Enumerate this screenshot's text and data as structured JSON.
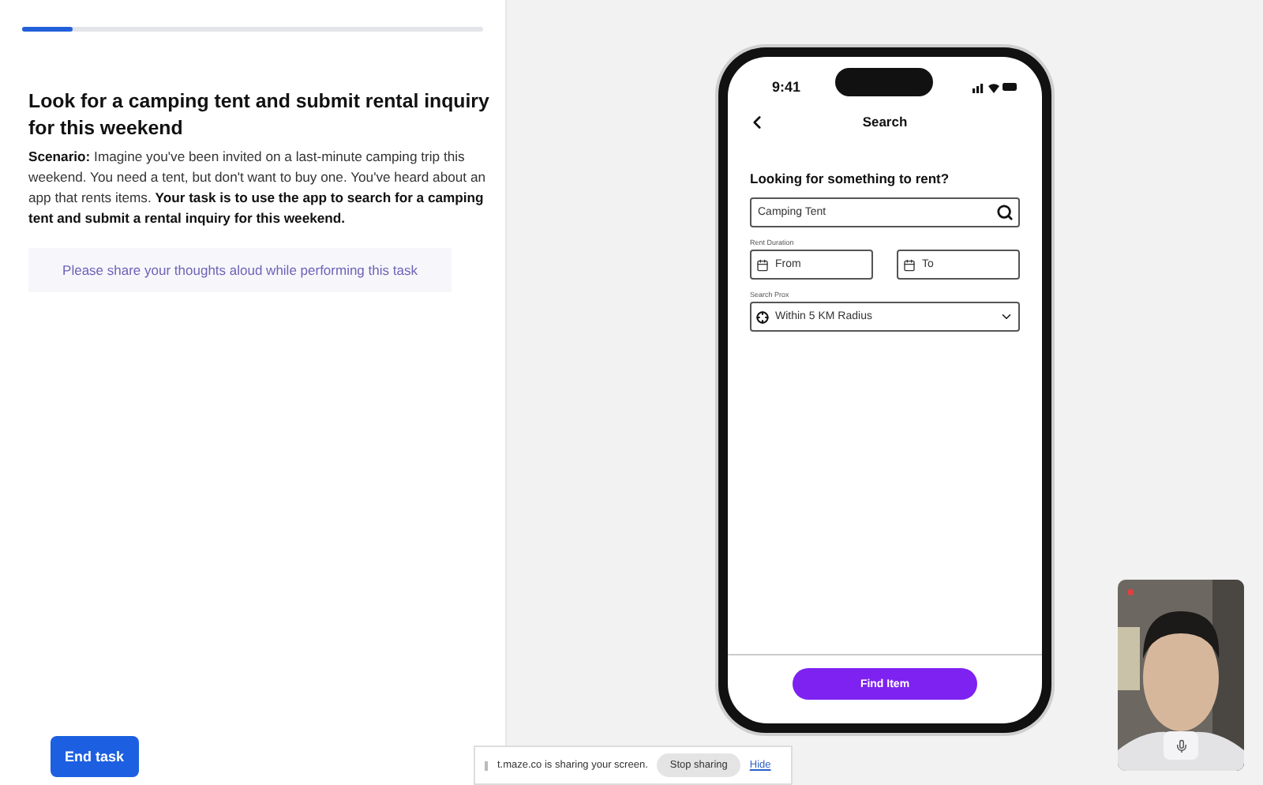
{
  "progress": {
    "level": 0.11
  },
  "task": {
    "title": "Look for a camping tent and submit rental inquiry for this weekend",
    "scenario": "**Scenario:** Imagine you've been invited on a last-minute camping trip this weekend. You need a tent, but don't want to buy one. You've heard about an app that rents items. **Your task is to use the app to search for a camping tent and submit a rental inquiry for this weekend.**",
    "hint": "Please share your thoughts aloud while performing this task"
  },
  "end_button": "End task",
  "phone": {
    "time": "9:41",
    "screen_title": "Search",
    "heading": "Looking for something to rent?",
    "search_value": "Camping Tent",
    "duration_label": "Rent Duration",
    "from_placeholder": "From",
    "to_placeholder": "To",
    "proximity_label": "Search Prox",
    "proximity_value": "Within 5 KM Radius",
    "action_button": "Find Item"
  },
  "share_bar": {
    "message": "t.maze.co is sharing your screen.",
    "stop_button": "Stop sharing",
    "hide_link": "Hide"
  },
  "webcam": {
    "recording": true
  }
}
